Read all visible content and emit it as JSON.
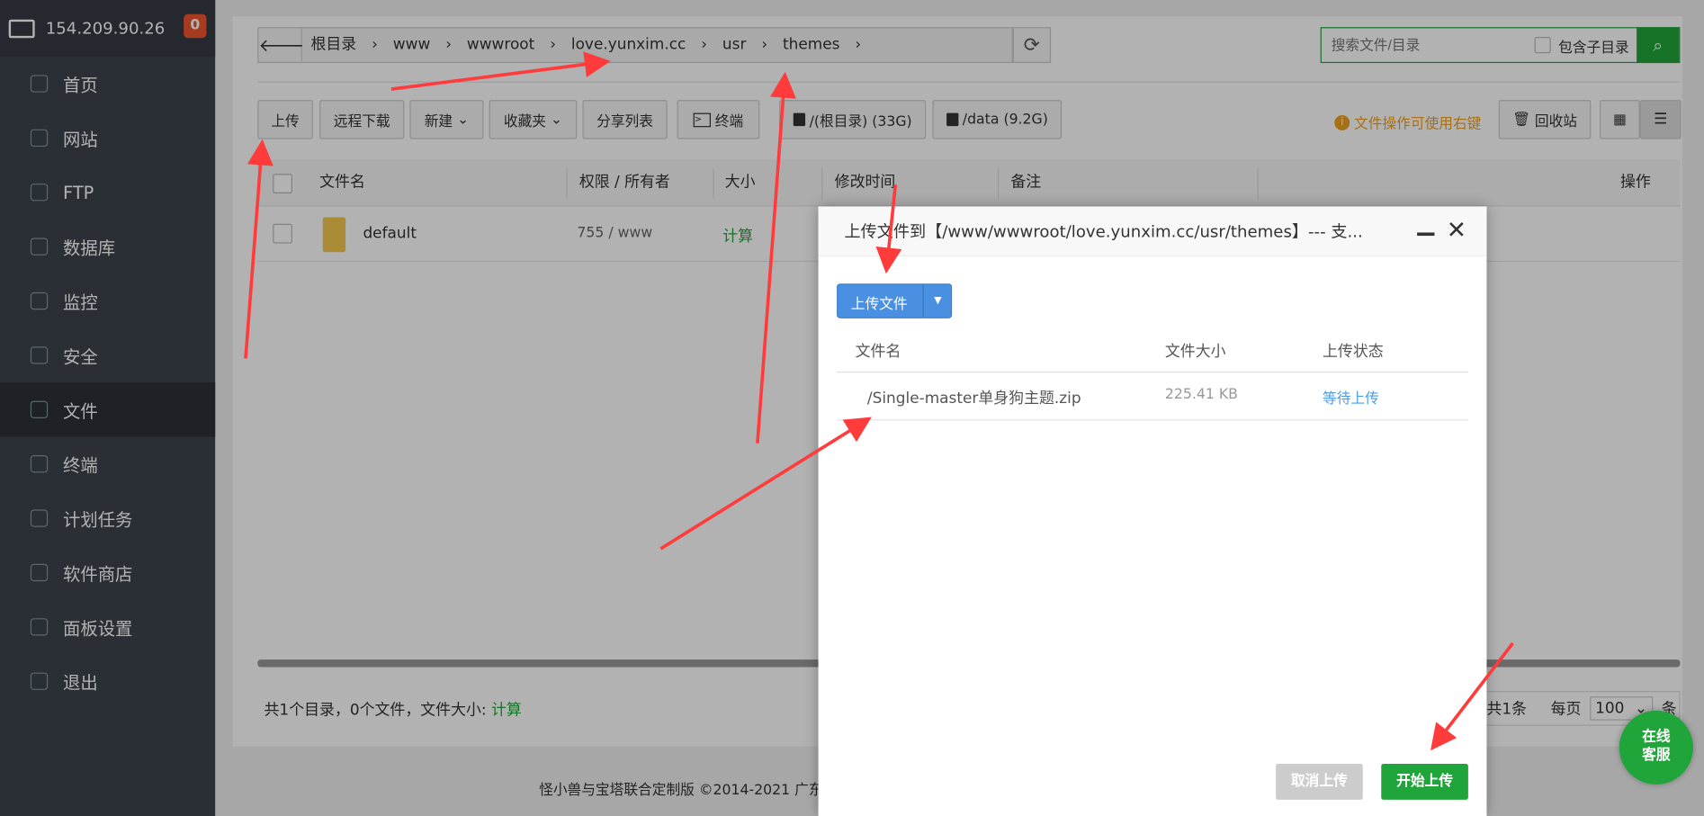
{
  "sidebar": {
    "host": "154.209.90.26",
    "badge": "0",
    "items": [
      {
        "label": "首页",
        "icon": "home-icon"
      },
      {
        "label": "网站",
        "icon": "globe-icon"
      },
      {
        "label": "FTP",
        "icon": "ftp-icon"
      },
      {
        "label": "数据库",
        "icon": "database-icon"
      },
      {
        "label": "监控",
        "icon": "monitor-icon"
      },
      {
        "label": "安全",
        "icon": "shield-icon"
      },
      {
        "label": "文件",
        "icon": "folder-icon",
        "active": true
      },
      {
        "label": "终端",
        "icon": "terminal-icon"
      },
      {
        "label": "计划任务",
        "icon": "calendar-icon"
      },
      {
        "label": "软件商店",
        "icon": "apps-icon"
      },
      {
        "label": "面板设置",
        "icon": "gear-icon"
      },
      {
        "label": "退出",
        "icon": "logout-icon"
      }
    ]
  },
  "breadcrumb": [
    "根目录",
    "www",
    "wwwroot",
    "love.yunxim.cc",
    "usr",
    "themes"
  ],
  "search": {
    "placeholder": "搜索文件/目录",
    "include_sub": "包含子目录"
  },
  "toolbar": {
    "upload": "上传",
    "remote_download": "远程下载",
    "new": "新建",
    "favorites": "收藏夹",
    "share_list": "分享列表",
    "terminal": "终端",
    "disk_root": "/(根目录) (33G)",
    "disk_data": "/data (9.2G)",
    "tip": "文件操作可使用右键",
    "recycle": "回收站"
  },
  "table": {
    "headers": [
      "文件名",
      "权限 / 所有者",
      "大小",
      "修改时间",
      "备注",
      "操作"
    ],
    "rows": [
      {
        "name": "default",
        "perm": "755 / www",
        "size": "计算"
      }
    ]
  },
  "footer": {
    "summary": "共1个目录，0个文件，文件大小:",
    "calc": "计算",
    "total": "共1条",
    "per_page": "每页",
    "per_page_value": "100",
    "unit": "条",
    "copyright": "怪小兽与宝塔联合定制版 ©2014-2021 广东"
  },
  "dialog": {
    "title": "上传文件到【/www/wwwroot/love.yunxim.cc/usr/themes】--- 支...",
    "upload_button": "上传文件",
    "headers": [
      "文件名",
      "文件大小",
      "上传状态"
    ],
    "files": [
      {
        "name": "/Single-master单身狗主题.zip",
        "size": "225.41 KB",
        "status": "等待上传"
      }
    ],
    "cancel": "取消上传",
    "start": "开始上传"
  },
  "chat": {
    "line1": "在线",
    "line2": "客服"
  },
  "colors": {
    "green": "#20a53a",
    "blue": "#4a90e2",
    "orange": "#f0a020",
    "annotation": "#ff3b3b"
  }
}
